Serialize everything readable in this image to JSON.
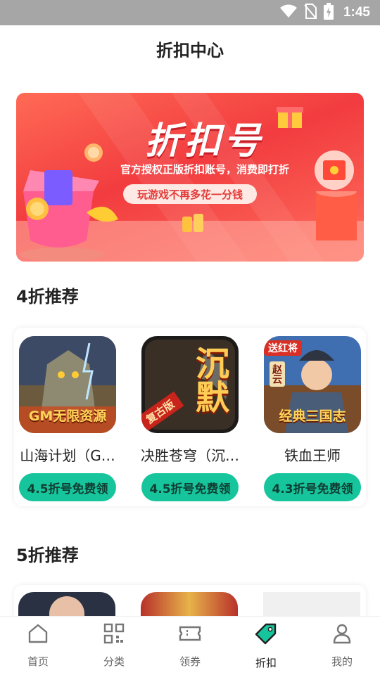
{
  "status_bar": {
    "time": "1:45",
    "icons": [
      "wifi-icon",
      "no-sim-icon",
      "battery-charging-icon"
    ]
  },
  "header": {
    "title": "折扣中心"
  },
  "banner": {
    "title": "折扣号",
    "subtitle": "官方授权正版折扣账号，消费即打折",
    "pill": "玩游戏不再多花一分钱"
  },
  "sections": [
    {
      "title": "4折推荐",
      "games": [
        {
          "name": "山海计划（G…",
          "button": "4.5折号免费领",
          "tile_text": "GM无限资源"
        },
        {
          "name": "决胜苍穹（沉…",
          "button": "4.5折号免费领",
          "tile_text": "沉默",
          "tile_badge": "复古版"
        },
        {
          "name": "铁血王师",
          "button": "4.3折号免费领",
          "tile_text": "经典三国志",
          "tile_badge": "送红将",
          "tile_side": "赵云"
        }
      ]
    },
    {
      "title": "5折推荐",
      "games": [
        {
          "name": "",
          "button": ""
        },
        {
          "name": "",
          "button": ""
        },
        {
          "name": "",
          "button": ""
        }
      ]
    }
  ],
  "bottom_nav": [
    {
      "label": "首页",
      "icon": "home-icon"
    },
    {
      "label": "分类",
      "icon": "grid-qr-icon"
    },
    {
      "label": "领券",
      "icon": "coupon-icon"
    },
    {
      "label": "折扣",
      "icon": "tag-icon",
      "active": true
    },
    {
      "label": "我的",
      "icon": "user-icon"
    }
  ],
  "colors": {
    "accent": "#17c59c",
    "banner": "#f23c3f",
    "status_bar": "#a6a6a6"
  }
}
